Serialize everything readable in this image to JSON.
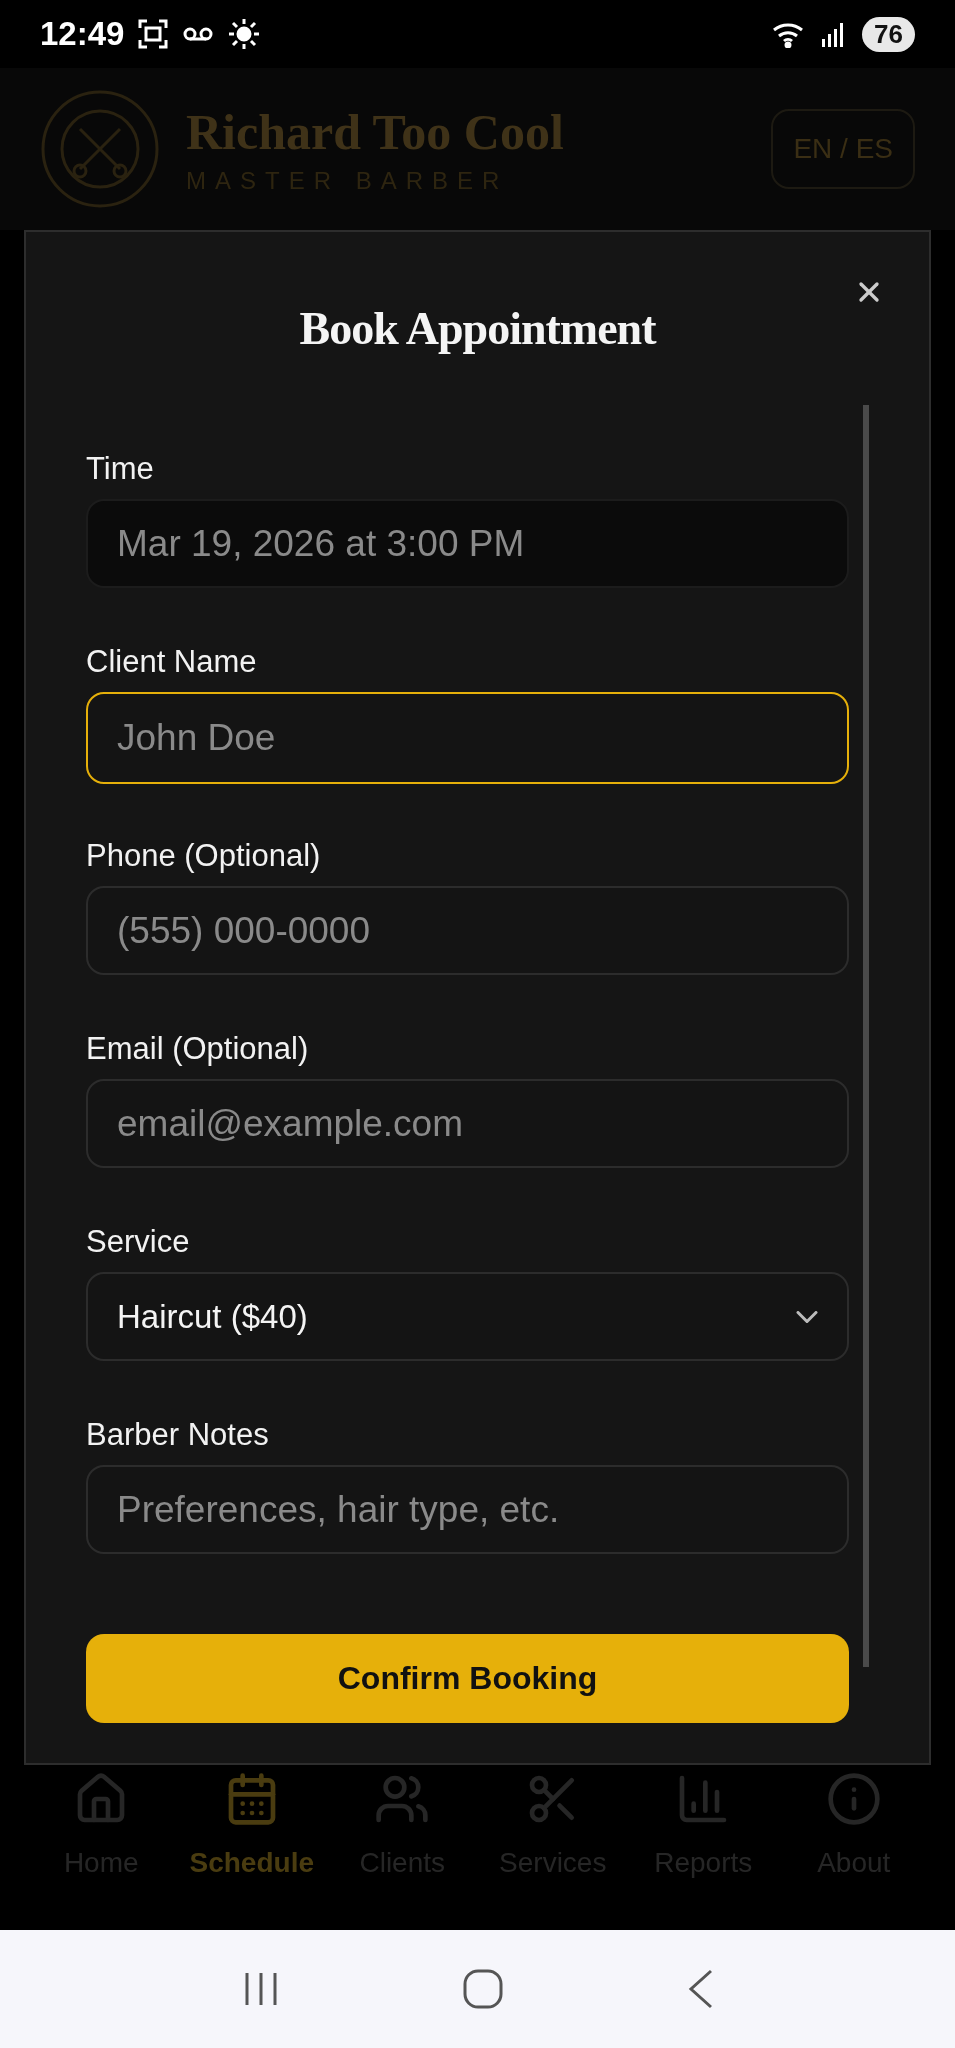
{
  "status_bar": {
    "time": "12:49",
    "battery": "76"
  },
  "header": {
    "title": "Richard Too Cool",
    "subtitle": "MASTER BARBER",
    "language_button": "EN / ES"
  },
  "dialog": {
    "title": "Book Appointment",
    "fields": [
      {
        "kind": "text",
        "label": "Time",
        "value": "Mar 19, 2026 at 3:00 PM",
        "disabled": true,
        "focused": false
      },
      {
        "kind": "text",
        "label": "Client Name",
        "placeholder": "John Doe",
        "disabled": false,
        "focused": true
      },
      {
        "kind": "text",
        "label": "Phone (Optional)",
        "placeholder": "(555) 000-0000",
        "disabled": false,
        "focused": false
      },
      {
        "kind": "text",
        "label": "Email (Optional)",
        "placeholder": "email@example.com",
        "disabled": false,
        "focused": false
      },
      {
        "kind": "select",
        "label": "Service",
        "value": "Haircut ($40)",
        "disabled": false,
        "focused": false
      },
      {
        "kind": "text",
        "label": "Barber Notes",
        "placeholder": "Preferences, hair type, etc.",
        "disabled": false,
        "focused": false
      }
    ],
    "submit": "Confirm Booking"
  },
  "bottom_nav": [
    {
      "kind": "home",
      "label": "Home",
      "selected": false
    },
    {
      "kind": "schedule",
      "label": "Schedule",
      "selected": true
    },
    {
      "kind": "clients",
      "label": "Clients",
      "selected": false
    },
    {
      "kind": "services",
      "label": "Services",
      "selected": false
    },
    {
      "kind": "reports",
      "label": "Reports",
      "selected": false
    },
    {
      "kind": "about",
      "label": "About",
      "selected": false
    }
  ]
}
